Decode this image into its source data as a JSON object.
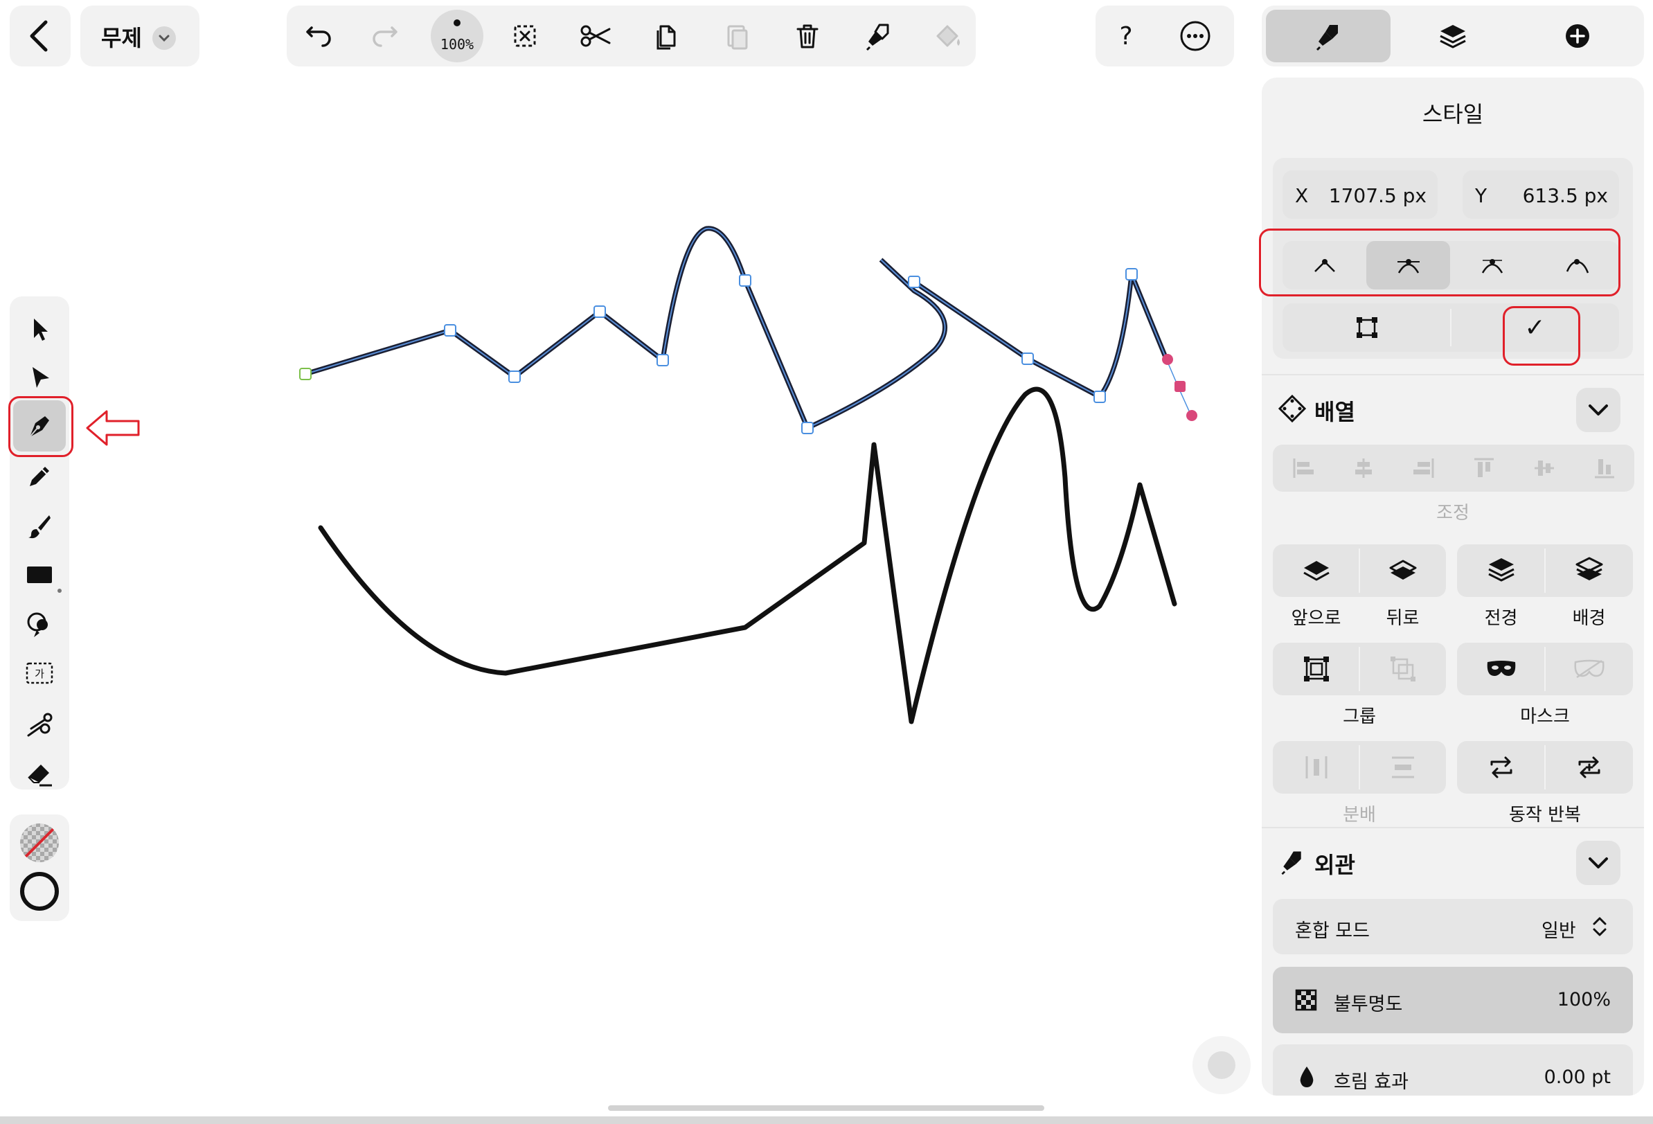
{
  "topbar": {
    "doc_title": "무제",
    "zoom_label": "100%",
    "help_label": "?"
  },
  "right_tabs": [
    "style",
    "layers",
    "add"
  ],
  "style_panel": {
    "title": "스타일",
    "x_label": "X",
    "x_value": "1707.5 px",
    "y_label": "Y",
    "y_value": "613.5 px",
    "confirm_glyph": "✓"
  },
  "arrange": {
    "title": "배열",
    "adjust_label": "조정",
    "front_label": "앞으로",
    "back_label": "뒤로",
    "to_front_label": "전경",
    "to_back_label": "배경",
    "group_label": "그룹",
    "mask_label": "마스크",
    "distribute_label": "분배",
    "repeat_label": "동작 반복"
  },
  "appearance": {
    "title": "외관",
    "blend_label": "혼합 모드",
    "blend_value": "일반",
    "opacity_label": "불투명도",
    "opacity_value": "100%",
    "blur_label": "흐림 효과",
    "blur_value": "0.00 pt"
  },
  "tools": [
    "select",
    "direct-select",
    "pen",
    "pencil",
    "brush",
    "rectangle",
    "shape-builder",
    "text",
    "scissors",
    "eraser"
  ],
  "colors": {
    "accent_red": "#e0202a",
    "anchor_blue": "#4a8fe0",
    "handle_pink": "#d9477a",
    "panel_bg": "#f2f2f2"
  }
}
